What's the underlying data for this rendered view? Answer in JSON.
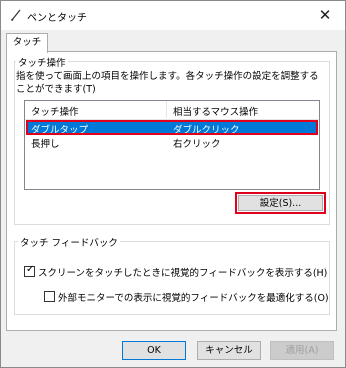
{
  "window": {
    "title": "ペンとタッチ",
    "close_glyph": "✕"
  },
  "tabs": [
    {
      "label": "タッチ",
      "selected": true
    }
  ],
  "touch_actions": {
    "group_title": "タッチ操作",
    "description": "指を使って画面上の項目を操作します。各タッチ操作の設定を調整することができます(T)",
    "columns": [
      "タッチ操作",
      "相当するマウス操作"
    ],
    "rows": [
      {
        "action": "ダブルタップ",
        "mouse": "ダブルクリック",
        "selected": true
      },
      {
        "action": "長押し",
        "mouse": "右クリック",
        "selected": false
      }
    ],
    "settings_button": "設定(S)..."
  },
  "feedback": {
    "group_title": "タッチ フィードバック",
    "show_visual_feedback": {
      "label": "スクリーンをタッチしたときに視覚的フィードバックを表示する(H)",
      "checked": true
    },
    "optimize_external": {
      "label": "外部モニターでの表示に視覚的フィードバックを最適化する(O)",
      "checked": false
    }
  },
  "footer": {
    "ok": "OK",
    "cancel": "キャンセル",
    "apply": "適用(A)"
  },
  "colors": {
    "selection": "#0078d7",
    "highlight_frame": "#e0001b"
  }
}
